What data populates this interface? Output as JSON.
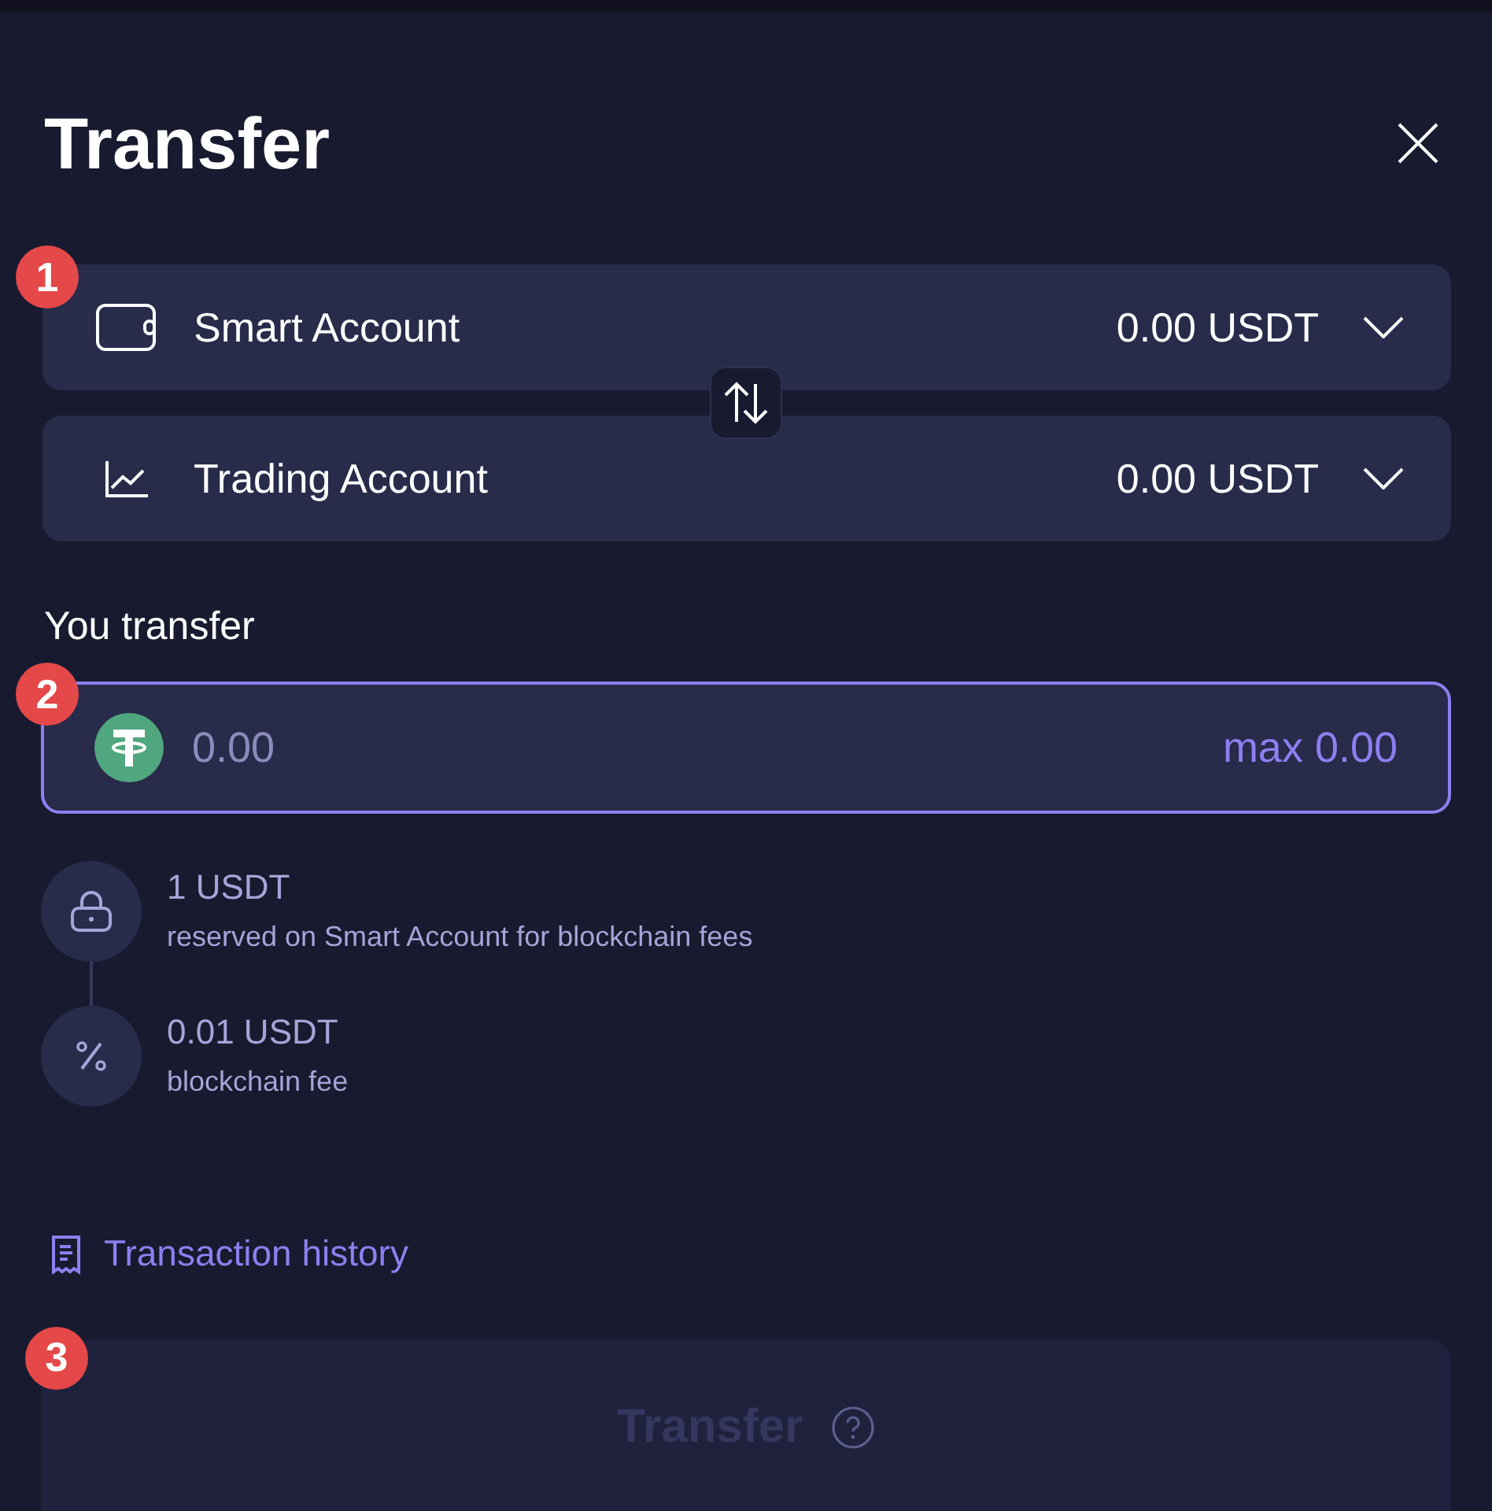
{
  "dialog": {
    "title": "Transfer"
  },
  "accounts": [
    {
      "kind": "wallet",
      "marker": "1",
      "name": "Smart Account",
      "balance": "0.00 USDT"
    },
    {
      "kind": "chart",
      "name": "Trading Account",
      "balance": "0.00 USDT"
    }
  ],
  "amount": {
    "label": "You transfer",
    "marker": "2",
    "placeholder": "0.00",
    "max": "max 0.00"
  },
  "fees": [
    {
      "kind": "lock",
      "amount": "1 USDT",
      "note": "reserved on Smart Account for blockchain fees"
    },
    {
      "kind": "percent",
      "amount": "0.01 USDT",
      "note": "blockchain fee"
    }
  ],
  "history_link": "Transaction history",
  "submit": {
    "marker": "3",
    "label": "Transfer",
    "disabled": true
  }
}
